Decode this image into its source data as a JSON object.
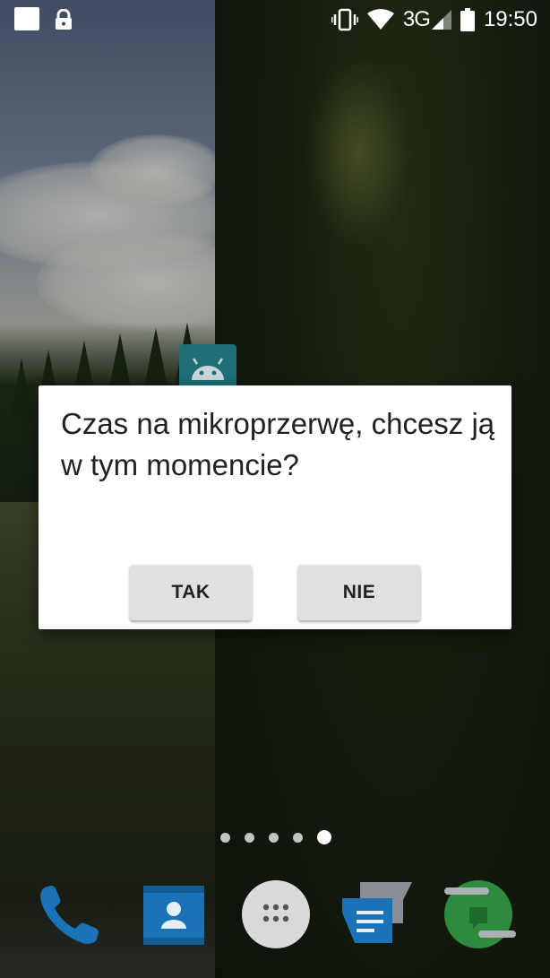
{
  "status_bar": {
    "network_label": "3G",
    "time": "19:50",
    "icons": [
      "notification-square-icon",
      "lock-icon",
      "vibrate-icon",
      "wifi-icon",
      "cell-signal-icon",
      "battery-icon"
    ]
  },
  "dialog": {
    "message": "Czas na mikroprzerwę, chcesz ją w tym momencie?",
    "positive_label": "TAK",
    "negative_label": "NIE"
  },
  "home": {
    "page_count": 5,
    "active_page": 5,
    "dock": [
      "phone-icon",
      "contacts-icon",
      "app-drawer-icon",
      "messages-icon",
      "hangouts-icon"
    ]
  },
  "colors": {
    "dialog_bg": "#ffffff",
    "button_bg": "#e0e0e0",
    "text": "#212121",
    "dock_blue": "#1a73b8",
    "hangouts_green": "#2e8b3d"
  }
}
